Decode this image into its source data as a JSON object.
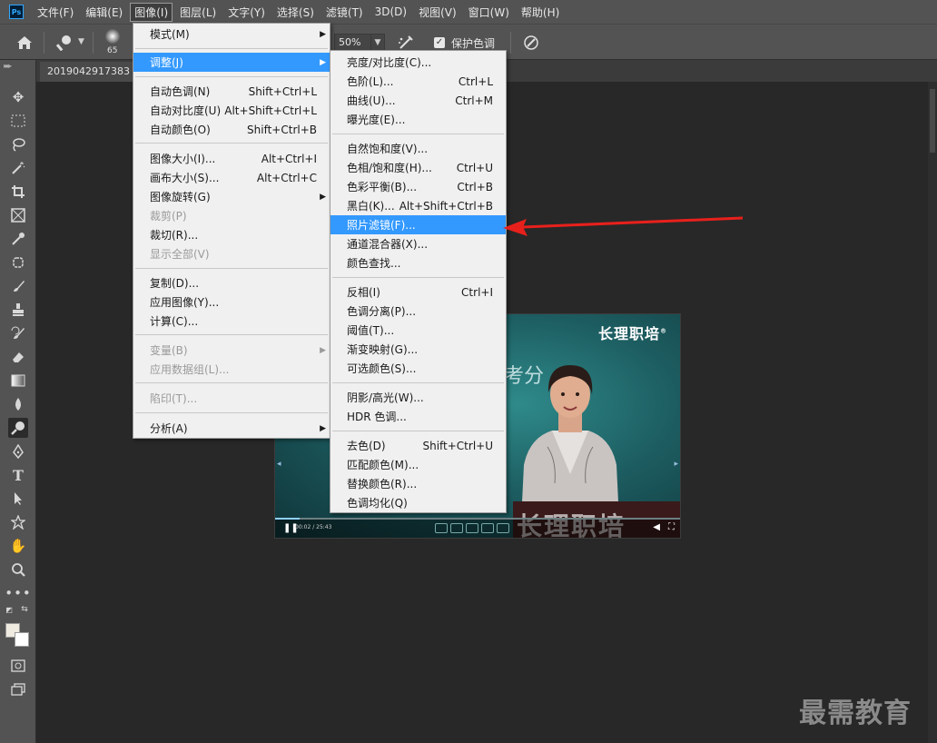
{
  "app": {
    "logo": "Ps"
  },
  "menubar": {
    "items": [
      "文件(F)",
      "编辑(E)",
      "图像(I)",
      "图层(L)",
      "文字(Y)",
      "选择(S)",
      "滤镜(T)",
      "3D(D)",
      "视图(V)",
      "窗口(W)",
      "帮助(H)"
    ],
    "active_index": 2
  },
  "options": {
    "brush_size": "65",
    "opacity": "50%",
    "protect_tones_label": "保护色调",
    "protect_tones_checked": true
  },
  "document": {
    "tab_title": "2019042917383"
  },
  "video": {
    "brand": "长理职培",
    "brand_mark": "®",
    "overlay_text": "考分",
    "podium_text": "长理职培",
    "time": "00:02 / 25:43",
    "progress_fraction": 0.06
  },
  "image_menu": {
    "items": [
      {
        "label": "模式(M)",
        "shortcut": "",
        "submenu": true,
        "disabled": false
      },
      {
        "label": "调整(J)",
        "shortcut": "",
        "submenu": true,
        "disabled": false,
        "highlight": true
      },
      {
        "label": "自动色调(N)",
        "shortcut": "Shift+Ctrl+L"
      },
      {
        "label": "自动对比度(U)",
        "shortcut": "Alt+Shift+Ctrl+L"
      },
      {
        "label": "自动颜色(O)",
        "shortcut": "Shift+Ctrl+B"
      },
      {
        "label": "图像大小(I)...",
        "shortcut": "Alt+Ctrl+I"
      },
      {
        "label": "画布大小(S)...",
        "shortcut": "Alt+Ctrl+C"
      },
      {
        "label": "图像旋转(G)",
        "shortcut": "",
        "submenu": true
      },
      {
        "label": "裁剪(P)",
        "shortcut": "",
        "disabled": true
      },
      {
        "label": "裁切(R)...",
        "shortcut": ""
      },
      {
        "label": "显示全部(V)",
        "shortcut": "",
        "disabled": true
      },
      {
        "label": "复制(D)...",
        "shortcut": ""
      },
      {
        "label": "应用图像(Y)...",
        "shortcut": ""
      },
      {
        "label": "计算(C)...",
        "shortcut": ""
      },
      {
        "label": "变量(B)",
        "shortcut": "",
        "submenu": true,
        "disabled": true
      },
      {
        "label": "应用数据组(L)...",
        "shortcut": "",
        "disabled": true
      },
      {
        "label": "陷印(T)...",
        "shortcut": "",
        "disabled": true
      },
      {
        "label": "分析(A)",
        "shortcut": "",
        "submenu": true
      }
    ]
  },
  "adjust_menu": {
    "items": [
      {
        "label": "亮度/对比度(C)...",
        "shortcut": ""
      },
      {
        "label": "色阶(L)...",
        "shortcut": "Ctrl+L"
      },
      {
        "label": "曲线(U)...",
        "shortcut": "Ctrl+M"
      },
      {
        "label": "曝光度(E)...",
        "shortcut": ""
      },
      {
        "label": "自然饱和度(V)...",
        "shortcut": ""
      },
      {
        "label": "色相/饱和度(H)...",
        "shortcut": "Ctrl+U"
      },
      {
        "label": "色彩平衡(B)...",
        "shortcut": "Ctrl+B"
      },
      {
        "label": "黑白(K)...",
        "shortcut": "Alt+Shift+Ctrl+B"
      },
      {
        "label": "照片滤镜(F)...",
        "shortcut": "",
        "highlight": true
      },
      {
        "label": "通道混合器(X)...",
        "shortcut": ""
      },
      {
        "label": "颜色查找...",
        "shortcut": ""
      },
      {
        "label": "反相(I)",
        "shortcut": "Ctrl+I"
      },
      {
        "label": "色调分离(P)...",
        "shortcut": ""
      },
      {
        "label": "阈值(T)...",
        "shortcut": ""
      },
      {
        "label": "渐变映射(G)...",
        "shortcut": ""
      },
      {
        "label": "可选颜色(S)...",
        "shortcut": ""
      },
      {
        "label": "阴影/高光(W)...",
        "shortcut": ""
      },
      {
        "label": "HDR 色调...",
        "shortcut": ""
      },
      {
        "label": "去色(D)",
        "shortcut": "Shift+Ctrl+U"
      },
      {
        "label": "匹配颜色(M)...",
        "shortcut": ""
      },
      {
        "label": "替换颜色(R)...",
        "shortcut": ""
      },
      {
        "label": "色调均化(Q)",
        "shortcut": ""
      }
    ]
  },
  "annotation": {
    "color": "#e8201c"
  },
  "watermark": "最需教育",
  "colors": {
    "highlight": "#3399ff",
    "foreground": "#f0ebe1",
    "background": "#ffffff"
  }
}
